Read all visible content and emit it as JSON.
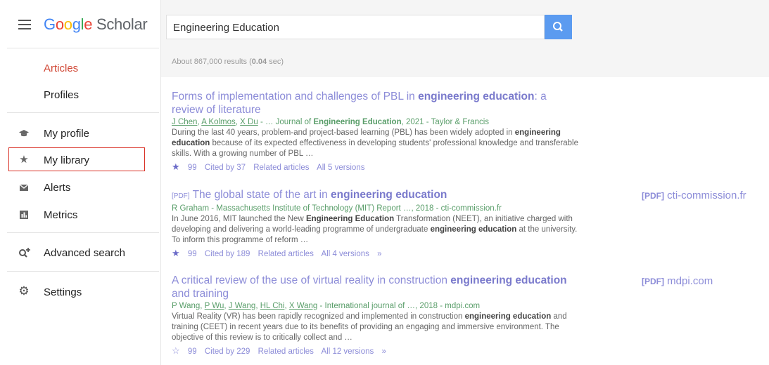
{
  "logo": {
    "google": "Google",
    "scholar": "Scholar"
  },
  "search": {
    "query": "Engineering Education"
  },
  "stats": {
    "prefix": "About 867,000 results (",
    "time": "0.04",
    "suffix": " sec)"
  },
  "sidebar": {
    "articles": "Articles",
    "profiles": "Profiles",
    "my_profile": "My profile",
    "my_library": "My library",
    "alerts": "Alerts",
    "metrics": "Metrics",
    "advanced_search": "Advanced search",
    "settings": "Settings"
  },
  "results": [
    {
      "title_a": "Forms of implementation and challenges of PBL in ",
      "title_b": "engineering education",
      "title_c": ": a review of literature",
      "authors": [
        "J Chen",
        "A Kolmos",
        "X Du"
      ],
      "meta_rest": " - … Journal of ",
      "meta_bold": "Engineering Education",
      "meta_tail": ", 2021 - Taylor & Francis",
      "snip_a": "During the last 40 years, problem-and project-based learning (PBL) has been widely adopted in ",
      "snip_b": "engineering education",
      "snip_c": " because of its expected effectiveness in developing students' professional knowledge and transferable skills. With a growing number of PBL …",
      "cite_icon": "99",
      "cited": "Cited by 37",
      "related": "Related articles",
      "versions": "All 5 versions"
    },
    {
      "tag": "[PDF]",
      "title_a": "The global state of the art in ",
      "title_b": "engineering education",
      "meta": "R Graham - Massachusetts Institute of Technology (MIT) Report …, 2018 - cti-commission.fr",
      "snip_a": "In June 2016, MIT launched the New ",
      "snip_b": "Engineering Education",
      "snip_c": " Transformation (NEET), an initiative charged with developing and delivering a world-leading programme of undergraduate ",
      "snip_d": "engineering education",
      "snip_e": " at the university. To inform this programme of reform …",
      "cite_icon": "99",
      "cited": "Cited by 189",
      "related": "Related articles",
      "versions": "All 4 versions",
      "side_pdf": "[PDF]",
      "side_domain": "cti-commission.fr"
    },
    {
      "title_a": "A critical review of the use of virtual reality in construction ",
      "title_b": "engineering education",
      "title_c": " and training",
      "meta_first": "P Wang, ",
      "authors": [
        "P Wu",
        "J Wang",
        "HL Chi",
        "X Wang"
      ],
      "meta_tail": " - International journal of …, 2018 - mdpi.com",
      "snip_a": "Virtual Reality (VR) has been rapidly recognized and implemented in construction ",
      "snip_b": "engineering education",
      "snip_c": " and training (CEET) in recent years due to its benefits of providing an engaging and immersive environment. The objective of this review is to critically collect and …",
      "cite_icon": "99",
      "cited": "Cited by 229",
      "related": "Related articles",
      "versions": "All 12 versions",
      "side_pdf": "[PDF]",
      "side_domain": "mdpi.com"
    }
  ]
}
